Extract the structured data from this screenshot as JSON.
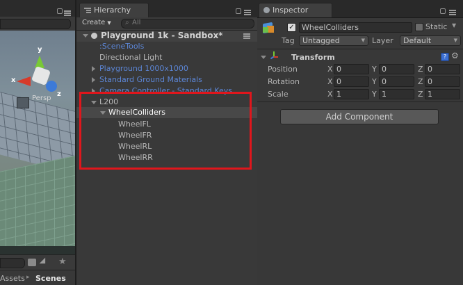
{
  "hierarchy": {
    "tab_label": "Hierarchy",
    "create_label": "Create",
    "search_placeholder": "All",
    "scene_name": "Playground 1k - Sandbox*",
    "items": [
      {
        "label": ":SceneTools",
        "color": "#5c86d6"
      },
      {
        "label": "Directional Light",
        "color": "#b9b9b9"
      },
      {
        "label": "Playground 1000x1000",
        "color": "#5c86d6"
      },
      {
        "label": "Standard Ground Materials",
        "color": "#5c86d6"
      },
      {
        "label": "Camera Controller - Standard Keys",
        "color": "#5c86d6"
      },
      {
        "label": "L200",
        "color": "#b9b9b9"
      },
      {
        "label": "WheelColliders",
        "color": "#ffffff"
      },
      {
        "label": "WheelFL",
        "color": "#b9b9b9"
      },
      {
        "label": "WheelFR",
        "color": "#b9b9b9"
      },
      {
        "label": "WheelRL",
        "color": "#b9b9b9"
      },
      {
        "label": "WheelRR",
        "color": "#b9b9b9"
      }
    ]
  },
  "inspector": {
    "tab_label": "Inspector",
    "object_name": "WheelColliders",
    "static_label": "Static",
    "tag_label": "Tag",
    "tag_value": "Untagged",
    "layer_label": "Layer",
    "layer_value": "Default",
    "component_title": "Transform",
    "axis_x": "X",
    "axis_y": "Y",
    "axis_z": "Z",
    "rows": [
      {
        "label": "Position",
        "x": "0",
        "y": "0",
        "z": "0"
      },
      {
        "label": "Rotation",
        "x": "0",
        "y": "0",
        "z": "0"
      },
      {
        "label": "Scale",
        "x": "1",
        "y": "1",
        "z": "1"
      }
    ],
    "add_component_label": "Add Component"
  },
  "scene": {
    "gizmo_y": "y",
    "gizmo_x": "x",
    "gizmo_z": "z",
    "persp_label": "Persp",
    "breadcrumb_assets": "Assets",
    "breadcrumb_sep": "▸",
    "breadcrumb_scenes": "Scenes"
  },
  "highlight_color": "#e0161c"
}
